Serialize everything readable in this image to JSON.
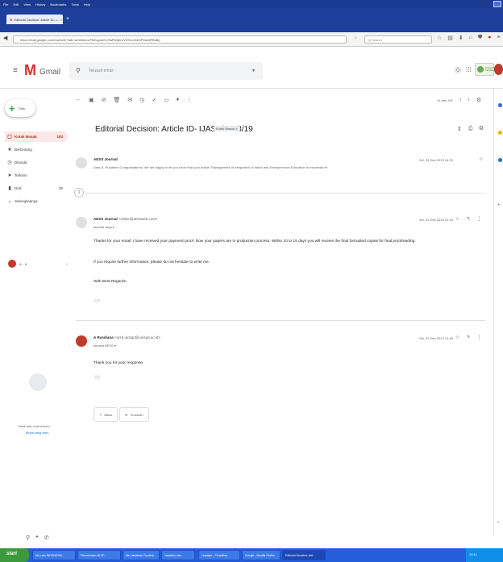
{
  "browser": {
    "menu": [
      "File",
      "Edit",
      "View",
      "History",
      "Bookmarks",
      "Tools",
      "Help"
    ],
    "tab_title": "Editorial Decision: Article ID- I... ×",
    "url": "https://mail.google.com/mail/u/0/?tab=wm#inbox/FMfcgxwGCHwRWjbvvVZSXcXbbhPbbnkRBsBp",
    "url_reload": "C",
    "search_placeholder": "Q Search"
  },
  "gmail": {
    "logo": "M",
    "name": "Gmail",
    "search_placeholder": "Telusuri email",
    "org_logo_text": "Universitas Lambung"
  },
  "sidebar": {
    "compose_label": "Tulis",
    "items": [
      {
        "icon": "▢",
        "label": "Kotak Masuk",
        "count": "183"
      },
      {
        "icon": "★",
        "label": "Berbintang",
        "count": ""
      },
      {
        "icon": "◷",
        "label": "Ditunda",
        "count": ""
      },
      {
        "icon": "➤",
        "label": "Terkirim",
        "count": ""
      },
      {
        "icon": "▮",
        "label": "Draf",
        "count": "35"
      },
      {
        "icon": "⌄",
        "label": "Selengkapnya",
        "count": ""
      }
    ],
    "hangout_user": "A... ▾",
    "no_chat": "Tidak ada chat terbaru",
    "start_new": "Mulai yang baru"
  },
  "toolbar": {
    "page_count": "31 dari 367"
  },
  "thread": {
    "subject": "Editorial Decision: Article ID- IJASS/2948/19",
    "label": "Kotak Masuk ×",
    "messages": [
      {
        "sender": "AESS Journal",
        "email": "",
        "snippet": "Dear A. Rusdiana Congratulations! We are happy to let you know that your article \"Management of Integration of Value and Entrepreneurs Education in Indonesia Hi",
        "date": "Sel, 24 Des 2019 16.33"
      },
      {
        "sender": "AESS Journal",
        "email": "<editor@aessweb.com>",
        "recipient": "kepada saya ▾",
        "date": "Sel, 31 Des 2019 12.34",
        "body": [
          "Thanks for your email. I have received your payment proof. Now your papers are in production process. Within 10 to 15 days you will receive the final formatted copies for final proofreading.",
          "If you require further information, please do not hesitate to write me.",
          "With Best Regards,"
        ],
        "ellipsis": "···"
      },
      {
        "sender": "A Rusdiana",
        "email": "<arsd.uinsgd@uinsgd.ac.id>",
        "recipient": "kepada AESS ▾",
        "date": "Sel, 31 Des 2019 13.48",
        "body": [
          "Thank you for your response."
        ],
        "ellipsis": "···"
      }
    ],
    "collapsed_count": "1",
    "reply_label": "Balas",
    "forward_label": "Teruskan"
  },
  "taskbar": {
    "start": "start",
    "tasks": [
      "Ms Lam-INDONESIA...",
      "Penerimaan AKTIF...",
      "Ms Lamaidan Fundrey",
      "Jawaban.wac",
      "Lepasjar - Penelitian...",
      "Google - Mozilla Firefox",
      "Editorial Decision: Arti..."
    ],
    "tray_time": "13:11"
  },
  "colors": {
    "gmail_red": "#d93025",
    "inbox_highlight": "#fce8e6",
    "taskbar_blue": "#245edb",
    "start_green": "#3c9a3c"
  }
}
